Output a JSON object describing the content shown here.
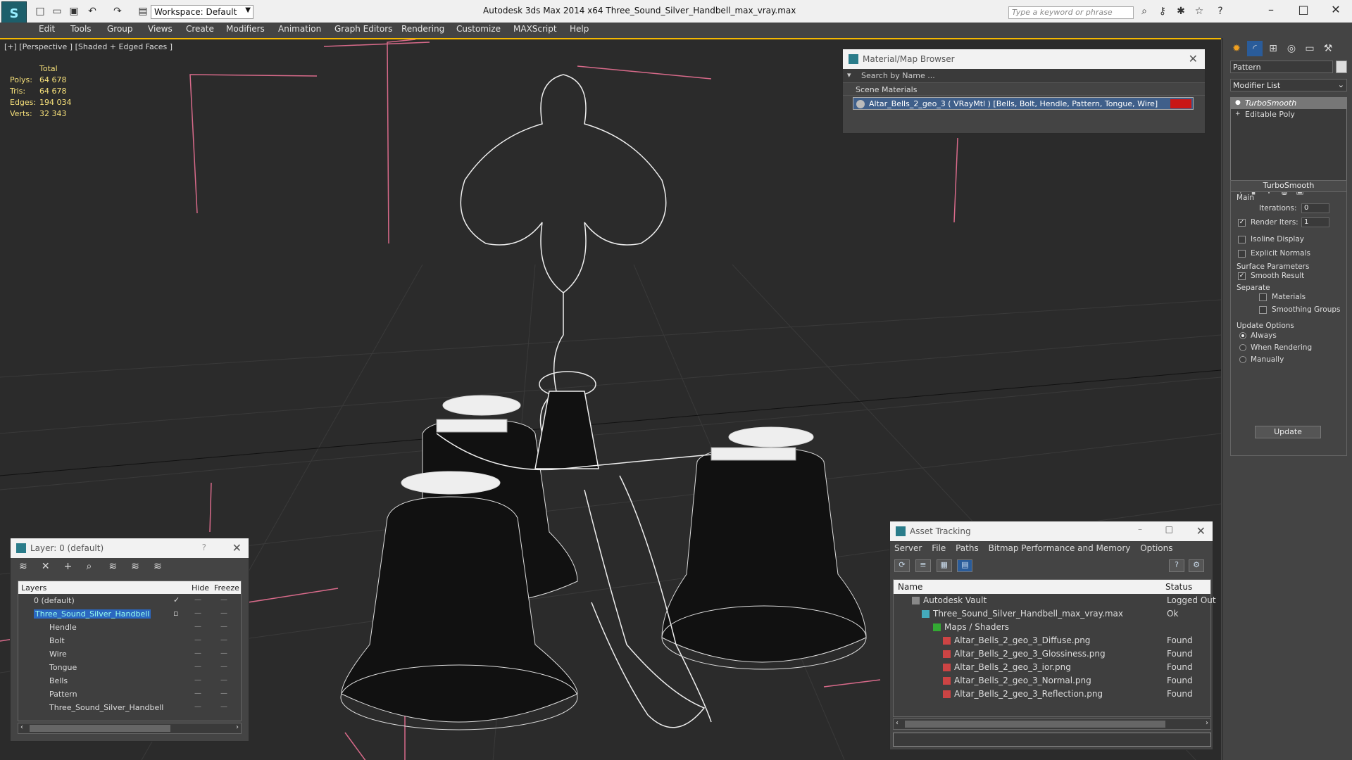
{
  "titlebar": {
    "workspace": "Workspace: Default",
    "app_title": "Autodesk 3ds Max  2014 x64      Three_Sound_Silver_Handbell_max_vray.max",
    "search_placeholder": "Type a keyword or phrase"
  },
  "menu": [
    "Edit",
    "Tools",
    "Group",
    "Views",
    "Create",
    "Modifiers",
    "Animation",
    "Graph Editors",
    "Rendering",
    "Customize",
    "MAXScript",
    "Help"
  ],
  "viewport": {
    "label": "[+] [Perspective ] [Shaded + Edged Faces ]",
    "stats": {
      "header": "Total",
      "polys_label": "Polys:",
      "polys": "64 678",
      "tris_label": "Tris:",
      "tris": "64 678",
      "edges_label": "Edges:",
      "edges": "194 034",
      "verts_label": "Verts:",
      "verts": "32 343"
    }
  },
  "material_browser": {
    "title": "Material/Map Browser",
    "search": "Search by Name ...",
    "group": "Scene Materials",
    "item": "Altar_Bells_2_geo_3  ( VRayMtl )  [Bells, Bolt, Hendle, Pattern, Tongue, Wire]"
  },
  "command_panel": {
    "object_name": "Pattern",
    "modifier_list": "Modifier List",
    "stack": [
      "TurboSmooth",
      "Editable Poly"
    ],
    "turbosmooth": {
      "title": "TurboSmooth",
      "main": "Main",
      "iterations_label": "Iterations:",
      "iterations": "0",
      "render_iters_label": "Render Iters:",
      "render_iters": "1",
      "isoline": "Isoline Display",
      "explicit_normals": "Explicit Normals",
      "surface_params": "Surface Parameters",
      "smooth_result": "Smooth Result",
      "separate": "Separate",
      "materials": "Materials",
      "smoothing_groups": "Smoothing Groups",
      "update_options": "Update Options",
      "always": "Always",
      "when_rendering": "When Rendering",
      "manually": "Manually",
      "update_btn": "Update"
    }
  },
  "layer_panel": {
    "title": "Layer: 0 (default)",
    "help": "?",
    "col_layers": "Layers",
    "col_hide": "Hide",
    "col_freeze": "Freeze",
    "rows": [
      {
        "name": "0 (default)"
      },
      {
        "name": "Three_Sound_Silver_Handbell"
      },
      {
        "name": "Hendle"
      },
      {
        "name": "Bolt"
      },
      {
        "name": "Wire"
      },
      {
        "name": "Tongue"
      },
      {
        "name": "Bells"
      },
      {
        "name": "Pattern"
      },
      {
        "name": "Three_Sound_Silver_Handbell"
      }
    ]
  },
  "asset_tracking": {
    "title": "Asset Tracking",
    "menu": [
      "Server",
      "File",
      "Paths",
      "Bitmap Performance and Memory",
      "Options"
    ],
    "col_name": "Name",
    "col_status": "Status",
    "rows": [
      {
        "name": "Autodesk Vault",
        "status": "Logged Out"
      },
      {
        "name": "Three_Sound_Silver_Handbell_max_vray.max",
        "status": "Ok"
      },
      {
        "name": "Maps / Shaders",
        "status": ""
      },
      {
        "name": "Altar_Bells_2_geo_3_Diffuse.png",
        "status": "Found"
      },
      {
        "name": "Altar_Bells_2_geo_3_Glossiness.png",
        "status": "Found"
      },
      {
        "name": "Altar_Bells_2_geo_3_ior.png",
        "status": "Found"
      },
      {
        "name": "Altar_Bells_2_geo_3_Normal.png",
        "status": "Found"
      },
      {
        "name": "Altar_Bells_2_geo_3_Reflection.png",
        "status": "Found"
      }
    ]
  }
}
